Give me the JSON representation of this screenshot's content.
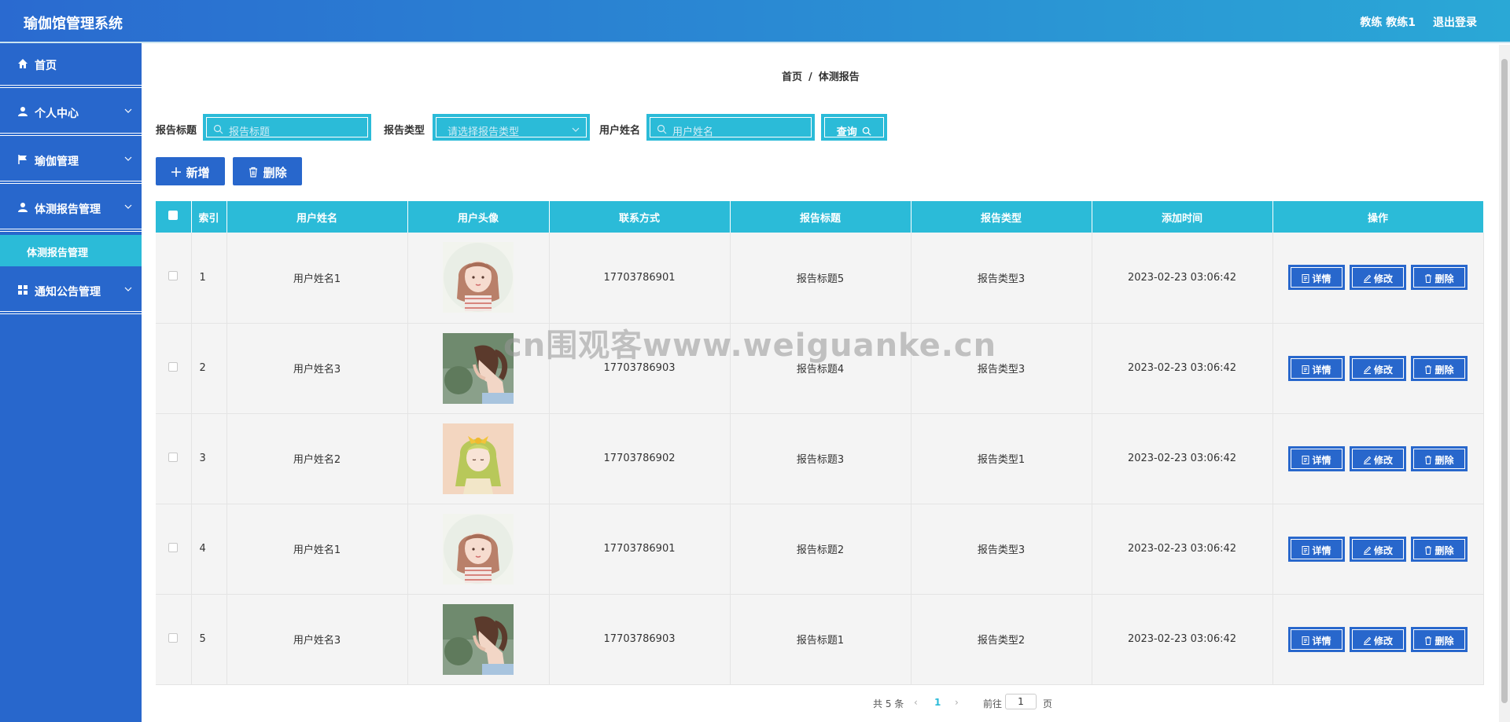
{
  "header": {
    "app_title": "瑜伽馆管理系统",
    "user_label": "教练 教练1",
    "logout_label": "退出登录"
  },
  "sidebar": {
    "items": [
      {
        "label": "首页",
        "icon": "home-icon"
      },
      {
        "label": "个人中心",
        "icon": "user-icon"
      },
      {
        "label": "瑜伽管理",
        "icon": "flag-icon"
      },
      {
        "label": "体测报告管理",
        "icon": "user-icon"
      },
      {
        "label": "通知公告管理",
        "icon": "grid-icon"
      }
    ],
    "active_submenu": "体测报告管理"
  },
  "breadcrumb": {
    "home": "首页",
    "separator": "/",
    "current": "体测报告"
  },
  "search": {
    "title_label": "报告标题",
    "title_placeholder": "报告标题",
    "type_label": "报告类型",
    "type_placeholder": "请选择报告类型",
    "name_label": "用户姓名",
    "name_placeholder": "用户姓名",
    "query_label": "查询"
  },
  "actions": {
    "add_label": "新增",
    "delete_label": "删除"
  },
  "table": {
    "headers": [
      "索引",
      "用户姓名",
      "用户头像",
      "联系方式",
      "报告标题",
      "报告类型",
      "添加时间",
      "操作"
    ],
    "rows": [
      {
        "index": "1",
        "name": "用户姓名1",
        "avatar": "avatar-girl-pink",
        "phone": "17703786901",
        "title": "报告标题5",
        "type": "报告类型3",
        "time": "2023-02-23 03:06:42"
      },
      {
        "index": "2",
        "name": "用户姓名3",
        "avatar": "avatar-girl-ponytail",
        "phone": "17703786903",
        "title": "报告标题4",
        "type": "报告类型3",
        "time": "2023-02-23 03:06:42"
      },
      {
        "index": "3",
        "name": "用户姓名2",
        "avatar": "avatar-girl-green-hair",
        "phone": "17703786902",
        "title": "报告标题3",
        "type": "报告类型1",
        "time": "2023-02-23 03:06:42"
      },
      {
        "index": "4",
        "name": "用户姓名1",
        "avatar": "avatar-girl-pink",
        "phone": "17703786901",
        "title": "报告标题2",
        "type": "报告类型3",
        "time": "2023-02-23 03:06:42"
      },
      {
        "index": "5",
        "name": "用户姓名3",
        "avatar": "avatar-girl-ponytail",
        "phone": "17703786903",
        "title": "报告标题1",
        "type": "报告类型2",
        "time": "2023-02-23 03:06:42"
      }
    ],
    "op_detail": "详情",
    "op_edit": "修改",
    "op_delete": "删除"
  },
  "pagination": {
    "total": "共 5 条",
    "current_page": "1",
    "goto_label": "前往",
    "goto_value": "1",
    "page_suffix": "页"
  },
  "watermark": "cn围观客www.weiguanke.cn",
  "colors": {
    "primary": "#2867cc",
    "accent": "#2bbbd8"
  }
}
